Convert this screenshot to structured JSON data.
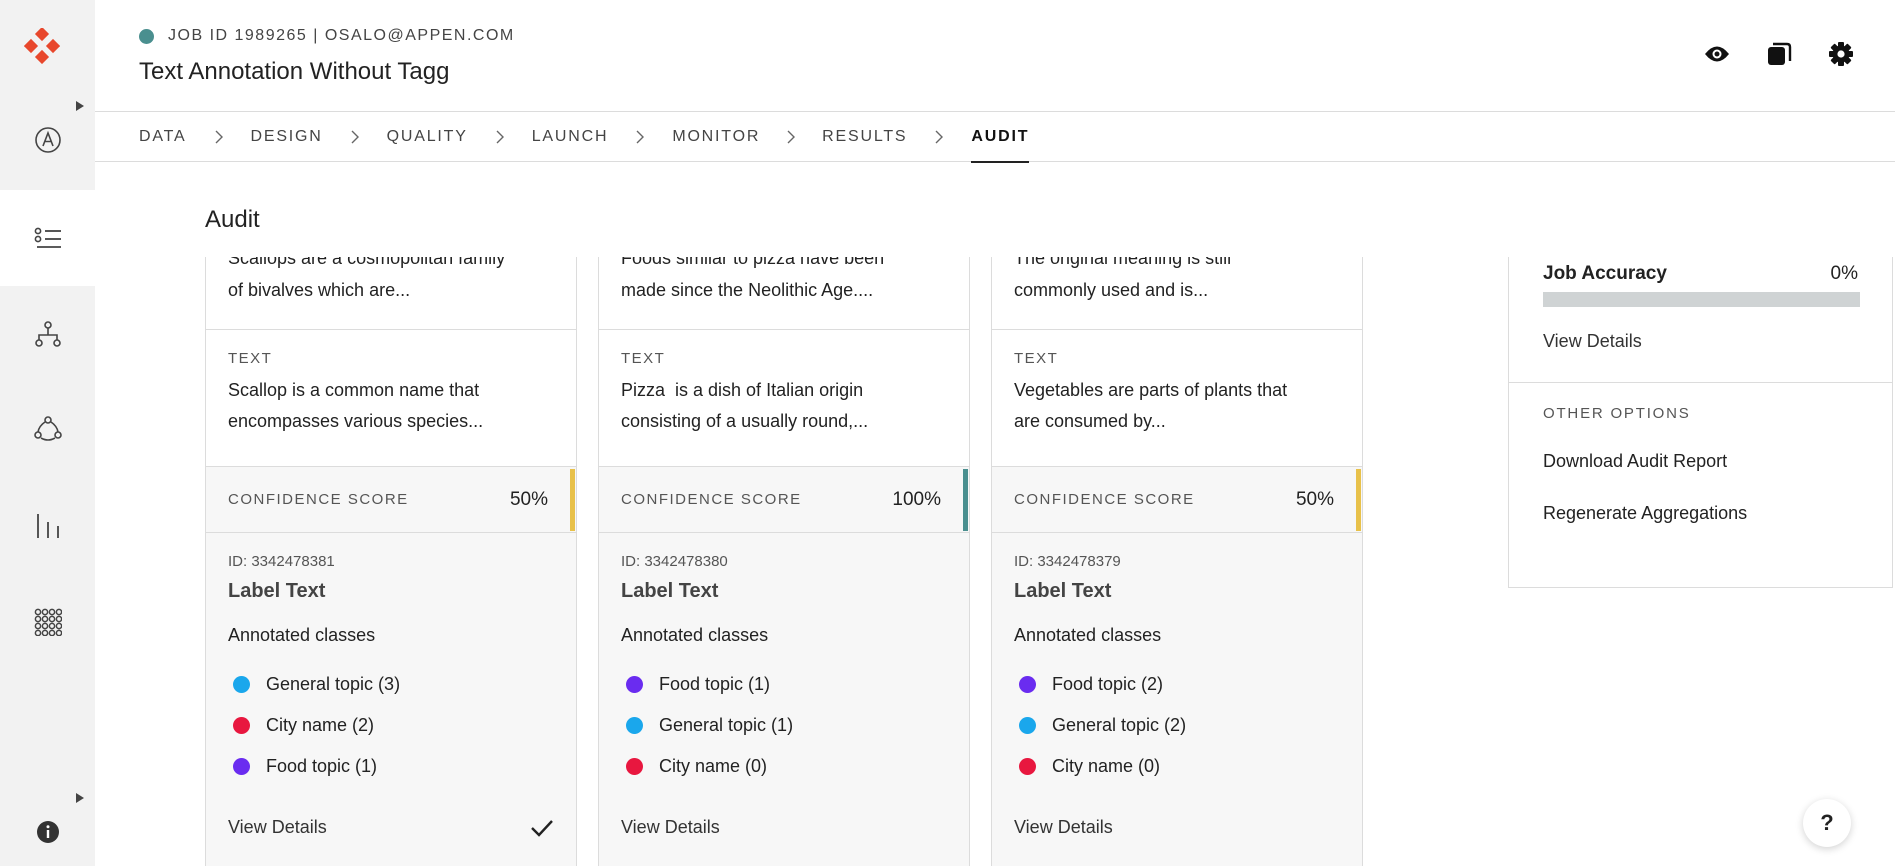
{
  "header": {
    "job_line": "JOB ID 1989265 | OSALO@APPEN.COM",
    "title": "Text Annotation Without Tagg",
    "status_color": "#4a8f8f"
  },
  "tabs": [
    {
      "label": "DATA",
      "active": false
    },
    {
      "label": "DESIGN",
      "active": false
    },
    {
      "label": "QUALITY",
      "active": false
    },
    {
      "label": "LAUNCH",
      "active": false
    },
    {
      "label": "MONITOR",
      "active": false
    },
    {
      "label": "RESULTS",
      "active": false
    },
    {
      "label": "AUDIT",
      "active": true
    }
  ],
  "page": {
    "title": "Audit"
  },
  "cards": [
    {
      "summary_line1": "Scallops are a cosmopolitan family",
      "summary_line2": "of bivalves which are...",
      "text_label": "TEXT",
      "text_line1": "Scallop is a common name that",
      "text_line2": "encompasses various species...",
      "confidence_label": "CONFIDENCE SCORE",
      "confidence_value": "50%",
      "confidence_color": "#e8c14a",
      "id": "ID: 3342478381",
      "label": "Label Text",
      "annotated": "Annotated classes",
      "classes": [
        {
          "name": "General topic (3)",
          "color": "#1aa7ec"
        },
        {
          "name": "City name (2)",
          "color": "#e8173f"
        },
        {
          "name": "Food topic (1)",
          "color": "#6a2cf0"
        }
      ],
      "view_details": "View Details",
      "checked": true
    },
    {
      "summary_line1": "Foods similar to pizza have been",
      "summary_line2": "made since the Neolithic Age....",
      "text_label": "TEXT",
      "text_line1": "Pizza  is a dish of Italian origin",
      "text_line2": "consisting of a usually round,...",
      "confidence_label": "CONFIDENCE SCORE",
      "confidence_value": "100%",
      "confidence_color": "#4a8f8f",
      "id": "ID: 3342478380",
      "label": "Label Text",
      "annotated": "Annotated classes",
      "classes": [
        {
          "name": "Food topic (1)",
          "color": "#6a2cf0"
        },
        {
          "name": "General topic (1)",
          "color": "#1aa7ec"
        },
        {
          "name": "City name (0)",
          "color": "#e8173f"
        }
      ],
      "view_details": "View Details",
      "checked": false
    },
    {
      "summary_line1": "The original meaning is still",
      "summary_line2": "commonly used and is...",
      "text_label": "TEXT",
      "text_line1": "Vegetables are parts of plants that",
      "text_line2": "are consumed by...",
      "confidence_label": "CONFIDENCE SCORE",
      "confidence_value": "50%",
      "confidence_color": "#e8c14a",
      "id": "ID: 3342478379",
      "label": "Label Text",
      "annotated": "Annotated classes",
      "classes": [
        {
          "name": "Food topic (2)",
          "color": "#6a2cf0"
        },
        {
          "name": "General topic (2)",
          "color": "#1aa7ec"
        },
        {
          "name": "City name (0)",
          "color": "#e8173f"
        }
      ],
      "view_details": "View Details",
      "checked": false
    }
  ],
  "right_panel": {
    "accuracy_label": "Job Accuracy",
    "accuracy_value": "0%",
    "accuracy_fraction": 0,
    "view_details": "View Details",
    "other_options": "OTHER OPTIONS",
    "download": "Download Audit Report",
    "regenerate": "Regenerate Aggregations"
  },
  "help": "?",
  "brand_color": "#e8472c"
}
